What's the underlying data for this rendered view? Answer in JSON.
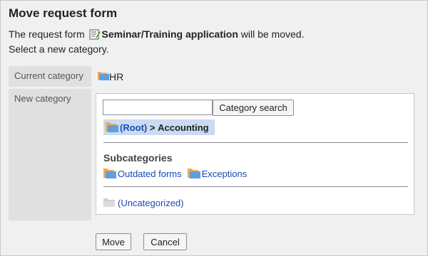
{
  "dialog": {
    "title": "Move request form",
    "desc_prefix": "The request form",
    "form_name": "Seminar/Training application",
    "desc_suffix": "will be moved.",
    "desc_line2": "Select a new category."
  },
  "current": {
    "label": "Current category",
    "value": "HR"
  },
  "new": {
    "label": "New category",
    "search_value": "",
    "search_button": "Category search",
    "breadcrumb_root": "(Root)",
    "breadcrumb_sep": " > ",
    "breadcrumb_current": "Accounting",
    "subcategories_heading": "Subcategories",
    "subcategories": [
      "Outdated forms",
      "Exceptions"
    ],
    "uncategorized": "(Uncategorized)"
  },
  "actions": {
    "move": "Move",
    "cancel": "Cancel"
  },
  "colors": {
    "link": "#1a4ab0",
    "selection": "#c8dbf3",
    "background": "#f0f0f0",
    "label_bg": "#e0e0e0"
  }
}
